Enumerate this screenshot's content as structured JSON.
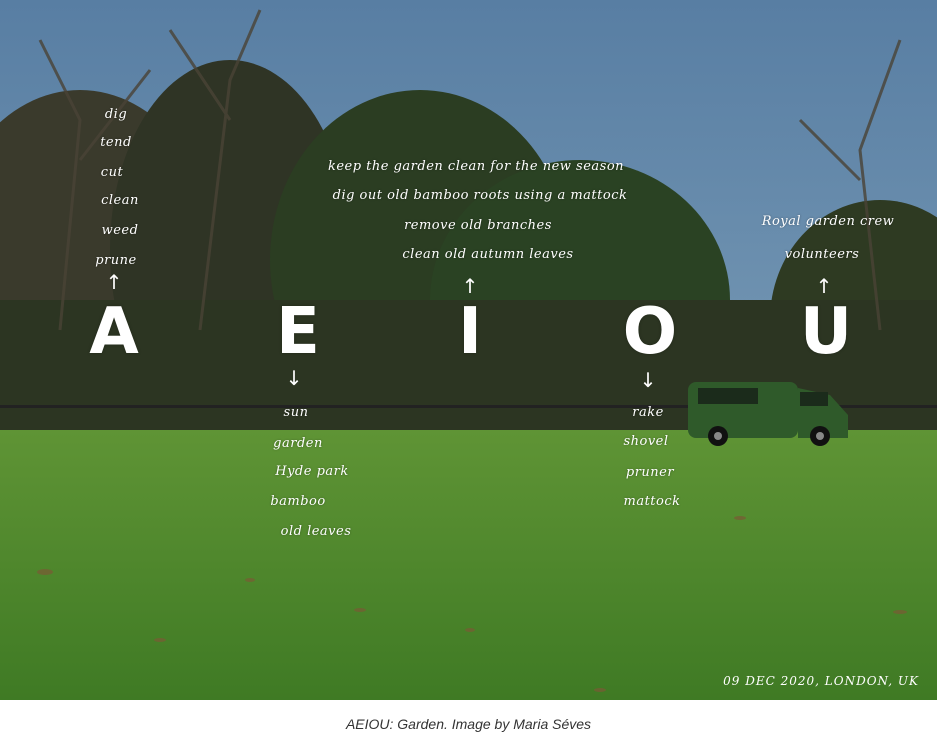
{
  "photo": {
    "vowels": [
      {
        "letter": "A",
        "words": [
          "dig",
          "tend",
          "cut",
          "clean",
          "weed",
          "prune"
        ]
      },
      {
        "letter": "E",
        "words": [
          "sun",
          "garden",
          "Hyde park",
          "bamboo",
          "old leaves"
        ]
      },
      {
        "letter": "I",
        "words": [
          "keep the garden clean for the new season",
          "dig out old bamboo roots using a mattock",
          "remove old branches",
          "clean old autumn leaves"
        ]
      },
      {
        "letter": "O",
        "words": [
          "rake",
          "shovel",
          "pruner",
          "mattock"
        ]
      },
      {
        "letter": "U",
        "words": [
          "Royal garden crew",
          "volunteers"
        ]
      }
    ],
    "arrows": {
      "up": "↑",
      "down": "↓"
    },
    "date_stamp": "09 DEC 2020, LONDON, UK"
  },
  "caption": "AEIOU: Garden. Image by Maria Séves",
  "colors": {
    "sky": "#6a8fae",
    "grass": "#4f8a2e",
    "trees": "#2f3a24",
    "van": "#2f5a2a",
    "text": "#ffffff"
  }
}
